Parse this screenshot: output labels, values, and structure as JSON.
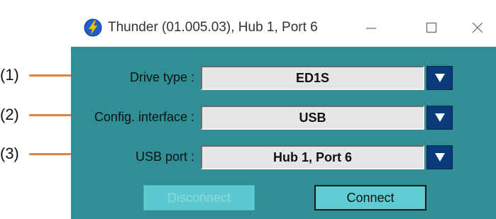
{
  "window": {
    "title": "Thunder (01.005.03), Hub 1, Port 6",
    "app_icon": "lightning-bolt-icon",
    "controls": [
      "minimize-icon",
      "maximize-icon",
      "close-icon"
    ]
  },
  "callouts": [
    {
      "label": "(1)"
    },
    {
      "label": "(2)"
    },
    {
      "label": "(3)"
    }
  ],
  "form": {
    "drive_type": {
      "label": "Drive type :",
      "value": "ED1S"
    },
    "config_interface": {
      "label": "Config. interface :",
      "value": "USB"
    },
    "usb_port": {
      "label": "USB port :",
      "value": "Hub 1, Port 6"
    }
  },
  "buttons": {
    "disconnect": {
      "label": "Disconnect",
      "enabled": false
    },
    "connect": {
      "label": "Connect",
      "enabled": true
    }
  },
  "colors": {
    "client_background": "#2f8f95",
    "dropdown_button": "#0a3a7a",
    "callout_line": "#e8823a",
    "button_face": "#5fcbd3"
  }
}
